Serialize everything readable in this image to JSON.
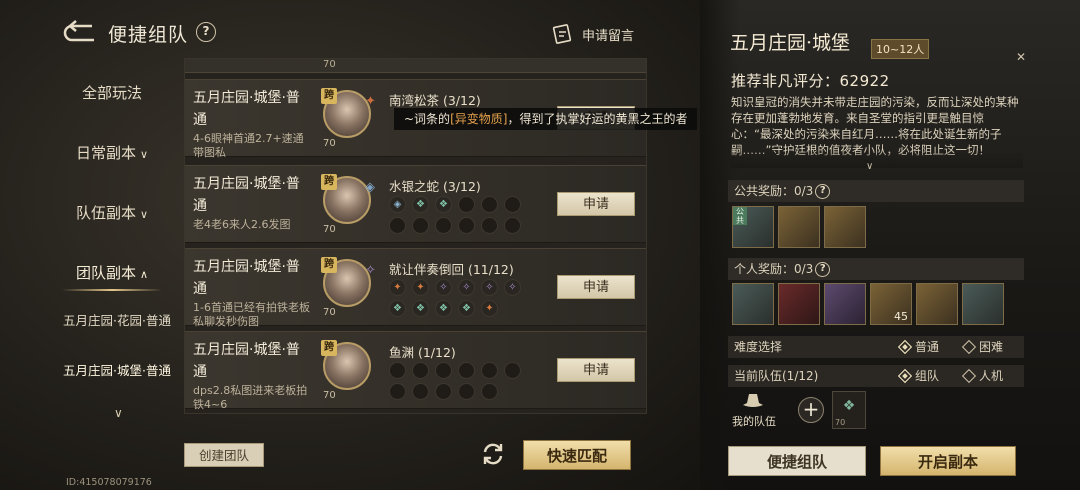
{
  "header": {
    "title": "便捷组队",
    "help_glyph": "?",
    "message_label": "申请留言"
  },
  "sidebar": {
    "items": [
      {
        "label": "全部玩法",
        "chevron": ""
      },
      {
        "label": "日常副本",
        "chevron": "∨"
      },
      {
        "label": "队伍副本",
        "chevron": "∨"
      },
      {
        "label": "团队副本",
        "chevron": "∧"
      }
    ],
    "sub_items": [
      {
        "label": "五月庄园·花园·普通"
      },
      {
        "label": "五月庄园·城堡·普通"
      }
    ],
    "more_glyph": "∨"
  },
  "list": {
    "top_level": "70",
    "rows": [
      {
        "title": "五月庄园·城堡·普通",
        "desc": "4-6眼神首通2.7+速通带图私",
        "team_name": "南湾松茶 (3/12)",
        "level": "70",
        "badge": "跨",
        "apply": "申请"
      },
      {
        "title": "五月庄园·城堡·普通",
        "desc": "老4老6来人2.6发图",
        "team_name": "水银之蛇 (3/12)",
        "level": "70",
        "badge": "跨",
        "apply": "申请"
      },
      {
        "title": "五月庄园·城堡·普通",
        "desc": "1-6首通已经有拍铁老板私聊发秒伤图",
        "team_name": "就让伴奏倒回 (11/12)",
        "level": "70",
        "badge": "跨",
        "apply": "申请"
      },
      {
        "title": "五月庄园·城堡·普通",
        "desc": "dps2.8私图进来老板拍铁4~6",
        "team_name": "鱼渊 (1/12)",
        "level": "70",
        "badge": "跨",
        "apply": "申请"
      }
    ]
  },
  "tooltip": {
    "prefix": "~词条的",
    "highlight": "[异变物质]",
    "suffix": "，得到了执掌好运的黄黑之王的者"
  },
  "bottom": {
    "create": "创建团队",
    "quick_match": "快速匹配",
    "user_id": "ID:415078079176"
  },
  "dungeon": {
    "name": "五月庄园·城堡",
    "level_range": "10~12人",
    "score": "推荐非凡评分：62922",
    "story": "知识皇冠的消失并未带走庄园的污染，反而让深处的某种存在更加蓬勃地发育。来自圣堂的指引更是触目惊心：“最深处的污染来自红月……将在此处诞生新的子嗣……”守护廷根的值夜者小队，必将阻止这一切！",
    "more": "∨",
    "public_reward": "公共奖励：0/3",
    "personal_reward": "个人奖励：0/3",
    "difficulty_label": "难度选择",
    "difficulty_options": [
      "普通",
      "困难"
    ],
    "team_label": "当前队伍(1/12)",
    "team_options": [
      "组队",
      "人机"
    ],
    "my_team": "我的队伍",
    "member_level": "70",
    "quick_team": "便捷组队",
    "open": "开启副本",
    "close": "✕",
    "reward_count": "45",
    "reward_tag": "公共"
  },
  "colors": {
    "accent_gold": "#d4b56e",
    "tooltip_highlight": "#e2a04b",
    "panel": "#26231e"
  }
}
